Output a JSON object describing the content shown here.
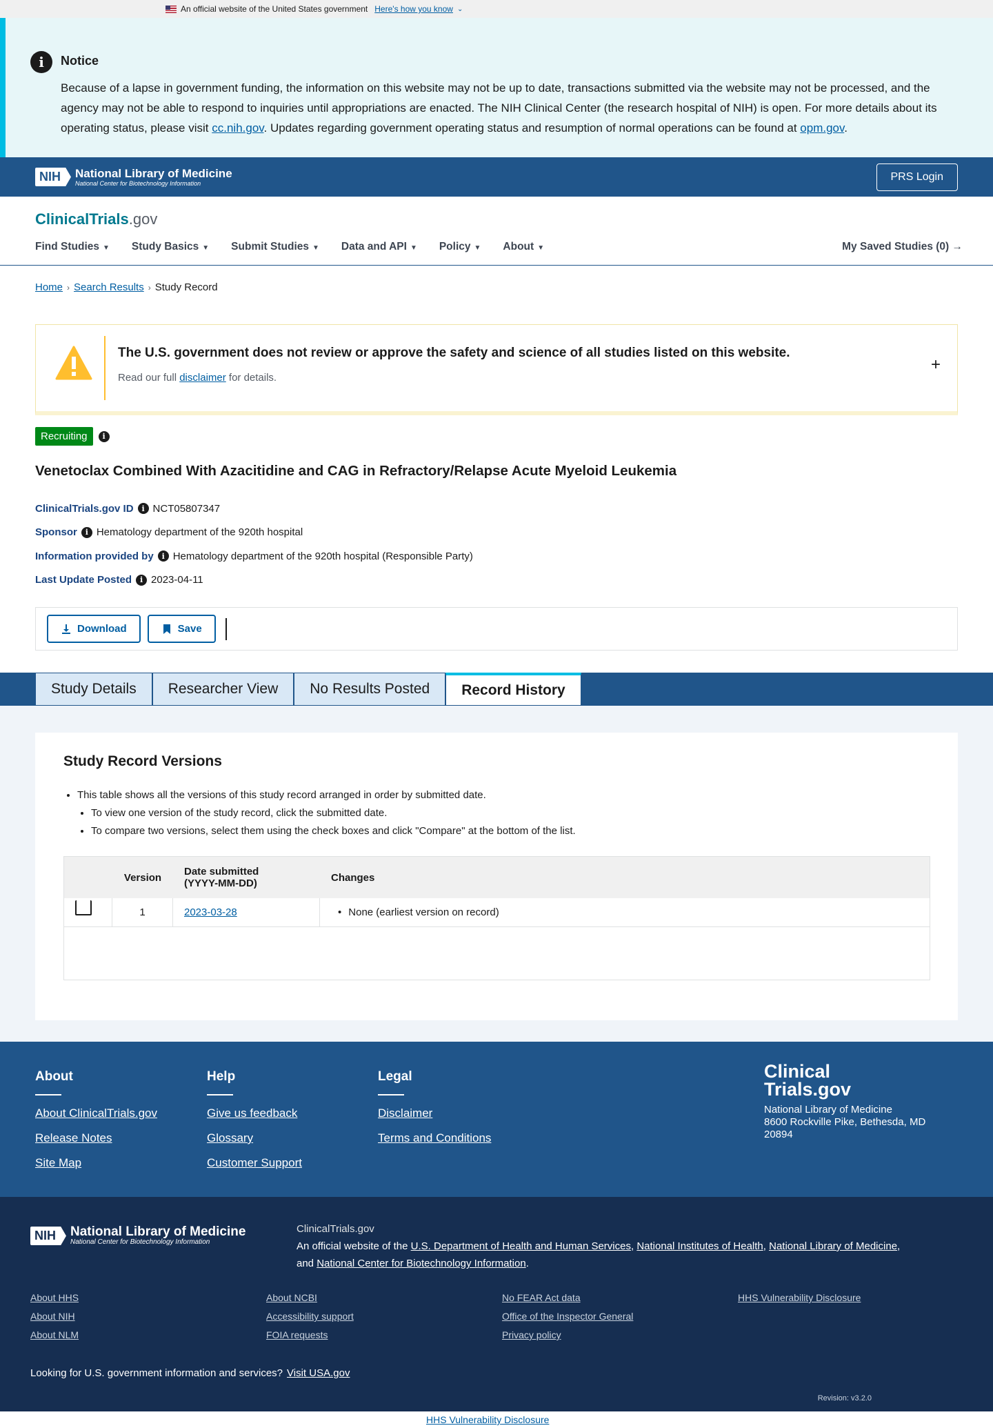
{
  "gov_banner": {
    "text": "An official website of the United States government",
    "link": "Here's how you know"
  },
  "notice": {
    "title": "Notice",
    "text_1": "Because of a lapse in government funding, the information on this website may not be up to date, transactions submitted via the website may not be processed, and the agency may not be able to respond to inquiries until appropriations are enacted. The NIH Clinical Center (the research hospital of NIH) is open. For more details about its operating status, please visit ",
    "link_1": "cc.nih.gov",
    "text_2": ". Updates regarding government operating status and resumption of normal operations can be found at ",
    "link_2": "opm.gov",
    "text_3": "."
  },
  "nih_bar": {
    "badge": "NIH",
    "title": "National Library of Medicine",
    "subtitle": "National Center for Biotechnology Information",
    "login": "PRS Login"
  },
  "site": {
    "brand_main": "ClinicalTrials",
    "brand_suffix": ".gov"
  },
  "nav": [
    {
      "label": "Find Studies"
    },
    {
      "label": "Study Basics"
    },
    {
      "label": "Submit Studies"
    },
    {
      "label": "Data and API"
    },
    {
      "label": "Policy"
    },
    {
      "label": "About"
    }
  ],
  "saved": "My Saved Studies (0)",
  "breadcrumb": {
    "home": "Home",
    "results": "Search Results",
    "current": "Study Record"
  },
  "disclaimer": {
    "heading": "The U.S. government does not review or approve the safety and science of all studies listed on this website.",
    "pre": "Read our full ",
    "link": "disclaimer",
    "post": " for details."
  },
  "status": "Recruiting",
  "study": {
    "title": "Venetoclax Combined With Azacitidine and CAG in Refractory/Relapse Acute Myeloid Leukemia",
    "id_label": "ClinicalTrials.gov ID",
    "id": "NCT05807347",
    "sponsor_label": "Sponsor",
    "sponsor": "Hematology department of the 920th hospital",
    "provided_label": "Information provided by",
    "provided": "Hematology department of the 920th hospital (Responsible Party)",
    "update_label": "Last Update Posted",
    "update": "2023-04-11"
  },
  "actions": {
    "download": "Download",
    "save": "Save"
  },
  "tabs": [
    {
      "label": "Study Details"
    },
    {
      "label": "Researcher View"
    },
    {
      "label": "No Results Posted"
    },
    {
      "label": "Record History"
    }
  ],
  "versions": {
    "heading": "Study Record Versions",
    "bullet_1": "This table shows all the versions of this study record arranged in order by submitted date.",
    "bullet_2": "To view one version of the study record, click the submitted date.",
    "bullet_3": "To compare two versions, select them using the check boxes and click \"Compare\" at the bottom of the list.",
    "col_version": "Version",
    "col_date_1": "Date submitted",
    "col_date_2": "(YYYY-MM-DD)",
    "col_changes": "Changes",
    "rows": [
      {
        "version": "1",
        "date": "2023-03-28",
        "changes": "None (earliest version on record)"
      }
    ]
  },
  "footer": {
    "about": {
      "heading": "About",
      "links": [
        "About ClinicalTrials.gov",
        "Release Notes",
        "Site Map"
      ]
    },
    "help": {
      "heading": "Help",
      "links": [
        "Give us feedback",
        "Glossary",
        "Customer Support"
      ]
    },
    "legal": {
      "heading": "Legal",
      "links": [
        "Disclaimer",
        "Terms and Conditions"
      ]
    },
    "brand_1": "Clinical",
    "brand_2": "Trials.gov",
    "addr_1": "National Library of Medicine",
    "addr_2": "8600 Rockville Pike, Bethesda, MD",
    "addr_3": "20894"
  },
  "footer2": {
    "site": "ClinicalTrials.gov",
    "official": "An official website of the ",
    "hhs": "U.S. Department of Health and Human Services",
    "nih": "National Institutes of Health",
    "nlm": "National Library of Medicine",
    "and": "and ",
    "ncbi": "National Center for Biotechnology Information",
    "col1": [
      "About HHS",
      "About NIH",
      "About NLM"
    ],
    "col2": [
      "About NCBI",
      "Accessibility support",
      "FOIA requests"
    ],
    "col3": [
      "No FEAR Act data",
      "Office of the Inspector General",
      "Privacy policy"
    ],
    "col4": [
      "HHS Vulnerability Disclosure"
    ],
    "usa_text": "Looking for U.S. government information and services?",
    "usa_link": "Visit USA.gov",
    "revision": "Revision: v3.2.0"
  },
  "bottom_link": "HHS Vulnerability Disclosure"
}
